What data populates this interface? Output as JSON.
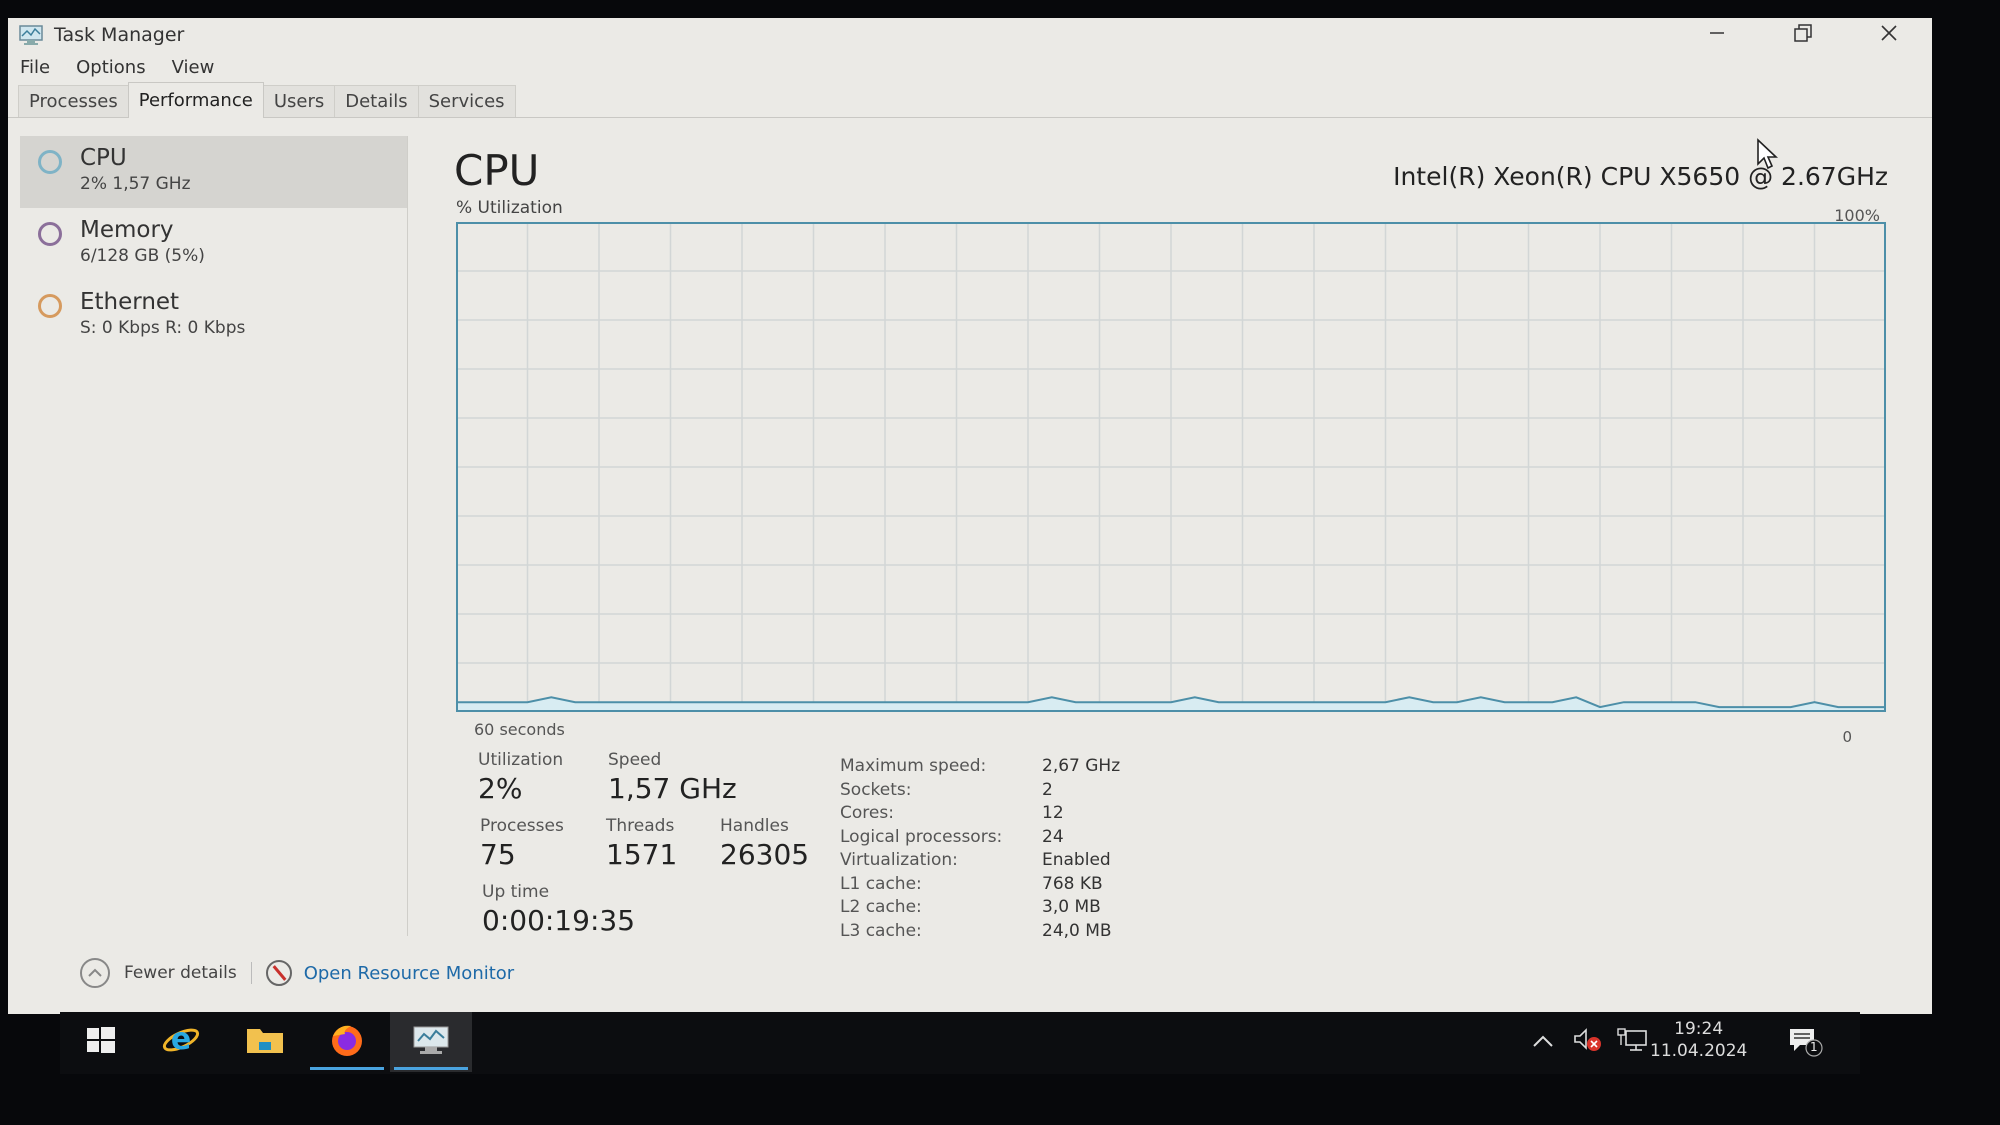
{
  "window": {
    "title": "Task Manager",
    "controls": {
      "minimize": "minimize-icon",
      "restore": "restore-icon",
      "close": "close-icon"
    }
  },
  "menu": [
    "File",
    "Options",
    "View"
  ],
  "tabs": [
    {
      "label": "Processes",
      "active": false
    },
    {
      "label": "Performance",
      "active": true
    },
    {
      "label": "Users",
      "active": false
    },
    {
      "label": "Details",
      "active": false
    },
    {
      "label": "Services",
      "active": false
    }
  ],
  "sidebar": {
    "items": [
      {
        "name": "CPU",
        "sub": "2%  1,57 GHz",
        "color": "#5b9bb6",
        "active": true
      },
      {
        "name": "Memory",
        "sub": "6/128 GB (5%)",
        "color": "#8b6f9a",
        "active": false
      },
      {
        "name": "Ethernet",
        "sub": "S: 0 Kbps  R: 0 Kbps",
        "color": "#c98a4b",
        "active": false
      }
    ]
  },
  "main": {
    "title": "CPU",
    "cpu_model": "Intel(R) Xeon(R) CPU X5650 @ 2.67GHz",
    "graph_label": "% Utilization",
    "graph_max_label": "100%",
    "graph_min_label": "0",
    "graph_time_label": "60 seconds",
    "graph_color": "#4d8fa8",
    "stats": {
      "utilization": {
        "label": "Utilization",
        "value": "2%"
      },
      "speed": {
        "label": "Speed",
        "value": "1,57 GHz"
      },
      "processes": {
        "label": "Processes",
        "value": "75"
      },
      "threads": {
        "label": "Threads",
        "value": "1571"
      },
      "handles": {
        "label": "Handles",
        "value": "26305"
      },
      "uptime": {
        "label": "Up time",
        "value": "0:00:19:35"
      }
    },
    "specs": [
      {
        "key": "Maximum speed:",
        "value": "2,67 GHz"
      },
      {
        "key": "Sockets:",
        "value": "2"
      },
      {
        "key": "Cores:",
        "value": "12"
      },
      {
        "key": "Logical processors:",
        "value": "24"
      },
      {
        "key": "Virtualization:",
        "value": "Enabled"
      },
      {
        "key": "L1 cache:",
        "value": "768 KB"
      },
      {
        "key": "L2 cache:",
        "value": "3,0 MB"
      },
      {
        "key": "L3 cache:",
        "value": "24,0 MB"
      }
    ]
  },
  "chart_data": {
    "type": "area",
    "title": "% Utilization",
    "xlabel": "60 seconds",
    "ylabel": "% Utilization",
    "ylim": [
      0,
      100
    ],
    "xlim": [
      60,
      0
    ],
    "grid": true,
    "x": [
      60,
      59,
      58,
      57,
      56,
      55,
      54,
      53,
      52,
      51,
      50,
      49,
      48,
      47,
      46,
      45,
      44,
      43,
      42,
      41,
      40,
      39,
      38,
      37,
      36,
      35,
      34,
      33,
      32,
      31,
      30,
      29,
      28,
      27,
      26,
      25,
      24,
      23,
      22,
      21,
      20,
      19,
      18,
      17,
      16,
      15,
      14,
      13,
      12,
      11,
      10,
      9,
      8,
      7,
      6,
      5,
      4,
      3,
      2,
      1,
      0
    ],
    "series": [
      {
        "name": "CPU",
        "values": [
          2,
          2,
          2,
          2,
          3,
          2,
          2,
          2,
          2,
          2,
          2,
          2,
          2,
          2,
          2,
          2,
          2,
          2,
          2,
          2,
          2,
          2,
          2,
          2,
          2,
          3,
          2,
          2,
          2,
          2,
          2,
          3,
          2,
          2,
          2,
          2,
          2,
          2,
          2,
          2,
          3,
          2,
          2,
          3,
          2,
          2,
          2,
          3,
          1,
          2,
          2,
          2,
          2,
          1,
          1,
          1,
          1,
          2,
          1,
          1,
          1
        ]
      }
    ]
  },
  "footer": {
    "fewer_details": "Fewer details",
    "open_resource_monitor": "Open Resource Monitor"
  },
  "taskbar": {
    "items": [
      {
        "name": "start",
        "icon": "windows-logo-icon"
      },
      {
        "name": "internet-explorer",
        "icon": "internet-explorer-icon"
      },
      {
        "name": "file-explorer",
        "icon": "folder-icon"
      },
      {
        "name": "firefox",
        "icon": "firefox-icon",
        "running": true
      },
      {
        "name": "task-manager",
        "icon": "task-manager-icon",
        "running": true,
        "focused": true
      }
    ],
    "tray": {
      "time": "19:24",
      "date": "11.04.2024",
      "notification_count": "1"
    }
  }
}
